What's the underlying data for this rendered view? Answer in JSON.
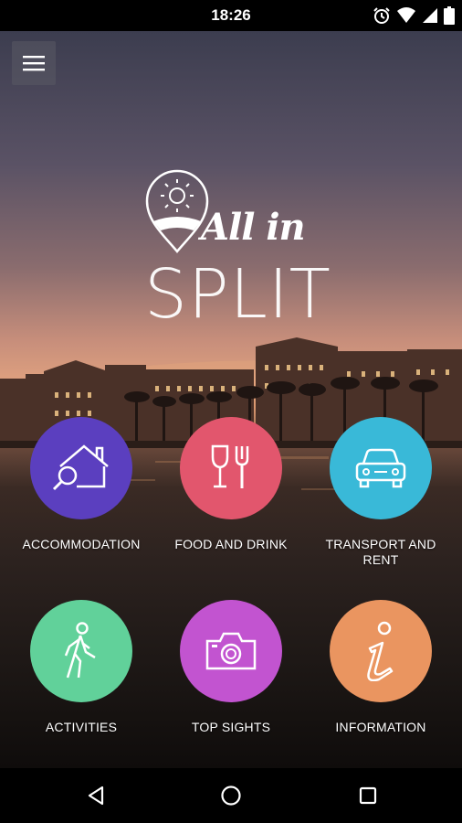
{
  "status": {
    "time": "18:26"
  },
  "logo": {
    "line1": "All in",
    "line2": "SPLIT"
  },
  "tiles": [
    {
      "label": "ACCOMMODATION",
      "icon": "house-search-icon",
      "color": "#5b3fbf"
    },
    {
      "label": "FOOD AND DRINK",
      "icon": "food-drink-icon",
      "color": "#e2566d"
    },
    {
      "label": "TRANSPORT AND RENT",
      "icon": "car-icon",
      "color": "#39b9d8"
    },
    {
      "label": "ACTIVITIES",
      "icon": "walking-person-icon",
      "color": "#61d19a"
    },
    {
      "label": "TOP SIGHTS",
      "icon": "camera-icon",
      "color": "#c254d0"
    },
    {
      "label": "INFORMATION",
      "icon": "info-icon",
      "color": "#ea9560"
    }
  ]
}
